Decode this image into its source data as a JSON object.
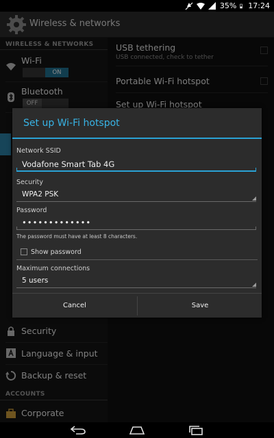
{
  "status_bar": {
    "battery": "35%",
    "time": "17:24"
  },
  "action_bar": {
    "title": "Wireless & networks",
    "icon": "settings-gear-icon"
  },
  "left_pane": {
    "section_wireless": "WIRELESS & NETWORKS",
    "wifi": {
      "label": "Wi-Fi",
      "toggle": "ON",
      "icon": "wifi-icon"
    },
    "bluetooth": {
      "label": "Bluetooth",
      "toggle": "OFF",
      "icon": "bluetooth-icon"
    },
    "security": {
      "label": "Security",
      "icon": "lock-icon"
    },
    "language": {
      "label": "Language & input",
      "icon": "keyboard-a-icon"
    },
    "backup": {
      "label": "Backup & reset",
      "icon": "backup-icon"
    },
    "section_accounts": "ACCOUNTS",
    "corporate": {
      "label": "Corporate",
      "icon": "briefcase-icon"
    }
  },
  "right_pane": {
    "usb_tethering": {
      "title": "USB tethering",
      "subtitle": "USB connected, check to tether"
    },
    "portable_hotspot": {
      "title": "Portable Wi-Fi hotspot"
    },
    "setup_hotspot": {
      "title": "Set up Wi-Fi hotspot"
    }
  },
  "dialog": {
    "title": "Set up Wi-Fi hotspot",
    "ssid_label": "Network SSID",
    "ssid_value": "Vodafone Smart Tab 4G",
    "security_label": "Security",
    "security_value": "WPA2 PSK",
    "password_label": "Password",
    "password_value": "•••••••••••••",
    "password_hint": "The password must have at least 8 characters.",
    "show_password_label": "Show password",
    "show_password_checked": false,
    "max_connections_label": "Maximum connections",
    "max_connections_value": "5 users",
    "cancel_label": "Cancel",
    "save_label": "Save"
  },
  "colors": {
    "accent": "#2aa3d6",
    "dialog_bg": "#2c2c2c",
    "toggle_on": "#1f6f8f"
  }
}
